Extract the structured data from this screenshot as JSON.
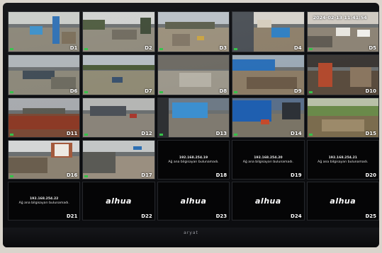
{
  "timestamp": "2024-02-13 11:41:54",
  "monitor_brand": "aryat",
  "logo_text": "alhua",
  "tiles": [
    {
      "label": "D1",
      "state": "live",
      "sky": "#c9ccc8",
      "ground": "#8a8577",
      "blocks": [
        [
          "#2d6fb3",
          62,
          10,
          10,
          70
        ],
        [
          "#3a8fc9",
          30,
          35,
          18,
          22
        ],
        [
          "#7a6d58",
          75,
          50,
          20,
          30
        ]
      ]
    },
    {
      "label": "D2",
      "state": "live",
      "sky": "#cfd1cf",
      "ground": "#8f8a7c",
      "blocks": [
        [
          "#4d5a3e",
          0,
          20,
          30,
          25
        ],
        [
          "#6f6a5e",
          40,
          45,
          35,
          25
        ],
        [
          "#3e4a36",
          80,
          15,
          15,
          40
        ]
      ]
    },
    {
      "label": "D3",
      "state": "live",
      "sky": "#b9c0c6",
      "ground": "#9a8f7b",
      "blocks": [
        [
          "#5b5e4c",
          10,
          25,
          70,
          18
        ],
        [
          "#c9a342",
          55,
          60,
          10,
          12
        ],
        [
          "#807565",
          20,
          55,
          25,
          30
        ]
      ]
    },
    {
      "label": "D4",
      "state": "live",
      "sky": "#d6d3cc",
      "ground": "#8d7f6a",
      "blocks": [
        [
          "#4a4f55",
          0,
          0,
          30,
          100
        ],
        [
          "#2f7fc2",
          55,
          40,
          25,
          25
        ],
        [
          "#d5cdbd",
          35,
          20,
          20,
          20
        ]
      ]
    },
    {
      "label": "D5",
      "state": "live",
      "timestamp": true,
      "sky": "#cfcac2",
      "ground": "#8c8375",
      "blocks": [
        [
          "#e8e6e0",
          40,
          40,
          20,
          20
        ],
        [
          "#f0efeb",
          70,
          45,
          18,
          18
        ],
        [
          "#5f5a52",
          0,
          60,
          35,
          30
        ]
      ]
    },
    {
      "label": "D6",
      "state": "live",
      "sky": "#aeb4b8",
      "ground": "#8b8779",
      "blocks": [
        [
          "#3f4b55",
          20,
          40,
          45,
          20
        ],
        [
          "#6c6a5f",
          60,
          55,
          35,
          30
        ]
      ]
    },
    {
      "label": "D7",
      "state": "live",
      "sky": "#b5bcc2",
      "ground": "#8f8a74",
      "blocks": [
        [
          "#4a5a38",
          0,
          25,
          100,
          12
        ],
        [
          "#38506d",
          40,
          55,
          15,
          15
        ]
      ]
    },
    {
      "label": "D8",
      "state": "live",
      "sky": "#c4c5c2",
      "ground": "#9c978b",
      "blocks": [
        [
          "#6d6a63",
          0,
          0,
          100,
          35
        ],
        [
          "#b5b1a6",
          30,
          45,
          45,
          35
        ]
      ]
    },
    {
      "label": "D9",
      "state": "live",
      "sky": "#9ca9b5",
      "ground": "#8c7c66",
      "blocks": [
        [
          "#2a6fb8",
          0,
          10,
          60,
          30
        ],
        [
          "#6b5a48",
          20,
          55,
          70,
          30
        ]
      ]
    },
    {
      "label": "D10",
      "state": "live",
      "sky": "#3c3835",
      "ground": "#5a4c3e",
      "blocks": [
        [
          "#b24a2e",
          15,
          20,
          20,
          60
        ],
        [
          "#8a7660",
          60,
          30,
          30,
          50
        ]
      ]
    },
    {
      "label": "D11",
      "state": "live",
      "sky": "#a7aaae",
      "ground": "#7a4a36",
      "blocks": [
        [
          "#8c3a26",
          0,
          45,
          100,
          35
        ],
        [
          "#5a5a52",
          20,
          25,
          60,
          15
        ]
      ]
    },
    {
      "label": "D12",
      "state": "live",
      "sky": "#b5b6b4",
      "ground": "#8a847a",
      "blocks": [
        [
          "#4c5158",
          10,
          20,
          50,
          25
        ],
        [
          "#a8382d",
          65,
          40,
          10,
          10
        ]
      ]
    },
    {
      "label": "D13",
      "state": "live",
      "sky": "#6e7a86",
      "ground": "#7f7a70",
      "blocks": [
        [
          "#3c8fcf",
          20,
          10,
          50,
          40
        ],
        [
          "#2e3033",
          0,
          0,
          15,
          100
        ]
      ]
    },
    {
      "label": "D14",
      "state": "live",
      "sky": "#5a6f8a",
      "ground": "#7a7466",
      "blocks": [
        [
          "#1f5fb0",
          0,
          5,
          55,
          55
        ],
        [
          "#c44a2c",
          40,
          55,
          12,
          12
        ],
        [
          "#2d3137",
          70,
          10,
          25,
          45
        ]
      ]
    },
    {
      "label": "D15",
      "state": "live",
      "sky": "#b8c0a8",
      "ground": "#7b6c4e",
      "blocks": [
        [
          "#6a8a4a",
          0,
          20,
          100,
          25
        ],
        [
          "#9c8a6a",
          20,
          55,
          60,
          30
        ]
      ]
    },
    {
      "label": "D16",
      "state": "live",
      "sky": "#d4d6d6",
      "ground": "#8c8272",
      "blocks": [
        [
          "#a45a3c",
          60,
          5,
          30,
          40
        ],
        [
          "#ede9e2",
          65,
          10,
          20,
          30
        ],
        [
          "#6a5e4e",
          0,
          45,
          55,
          40
        ]
      ]
    },
    {
      "label": "D17",
      "state": "live",
      "sky": "#c3c6c6",
      "ground": "#9a8f80",
      "blocks": [
        [
          "#5a5a55",
          0,
          30,
          45,
          55
        ],
        [
          "#2d6fb3",
          70,
          15,
          12,
          10
        ]
      ]
    },
    {
      "label": "D18",
      "state": "offline",
      "ip": "192.168.254.19",
      "message": "Ağ ana bilgisayarı bulunamadı."
    },
    {
      "label": "D19",
      "state": "offline",
      "ip": "192.168.254.20",
      "message": "Ağ ana bilgisayarı bulunamadı."
    },
    {
      "label": "D20",
      "state": "offline",
      "ip": "192.168.254.21",
      "message": "Ağ ana bilgisayarı bulunamadı."
    },
    {
      "label": "D21",
      "state": "offline",
      "ip": "192.168.254.22",
      "message": "Ağ ana bilgisayarı bulunamadı."
    },
    {
      "label": "D22",
      "state": "logo"
    },
    {
      "label": "D23",
      "state": "logo"
    },
    {
      "label": "D24",
      "state": "logo"
    },
    {
      "label": "D25",
      "state": "logo"
    }
  ]
}
